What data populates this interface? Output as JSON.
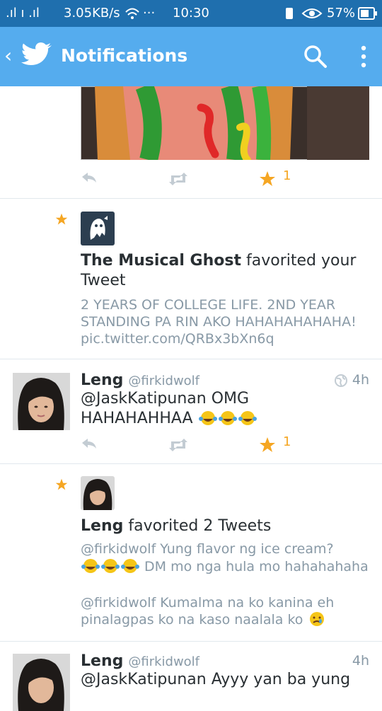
{
  "status_bar": {
    "signal": ".ıl ı .ıl",
    "network_speed": "3.05KB/s",
    "more": "···",
    "time": "10:30",
    "battery": "57%"
  },
  "app_bar": {
    "back": "‹",
    "title": "Notifications"
  },
  "first_tweet": {
    "favorite_count": "1"
  },
  "notifications": [
    {
      "actor": "The Musical Ghost",
      "action": "favorited your",
      "action_wrap": "Tweet",
      "tweet_lines": [
        "2 YEARS OF COLLEGE LIFE. 2ND YEAR",
        "STANDING PA RIN AKO HAHAHAHAHAHA!",
        "pic.twitter.com/QRBx3bXn6q"
      ]
    },
    {
      "actor": "Leng",
      "action": "favorited 2 Tweets",
      "tweet1_line1": "@firkidwolf Yung flavor ng ice cream?",
      "tweet1_line2": "DM mo nga hula mo hahahahaha",
      "tweet2_line1": "@firkidwolf Kumalma na ko kanina eh",
      "tweet2_line2": "pinalagpas ko na kaso naalala ko"
    }
  ],
  "tweets": [
    {
      "name": "Leng",
      "handle": "@firkidwolf",
      "time": "4h",
      "line1": "@JaskKatipunan OMG",
      "line2": "HAHAHAHHAA",
      "favorite_count": "1"
    },
    {
      "name": "Leng",
      "handle": "@firkidwolf",
      "time": "4h",
      "line1": "@JaskKatipunan Ayyy yan ba yung"
    }
  ],
  "colors": {
    "status_bar": "#1f6fae",
    "app_bar": "#55acee",
    "favorite": "#f5a623",
    "grey_text": "#8899a6"
  }
}
